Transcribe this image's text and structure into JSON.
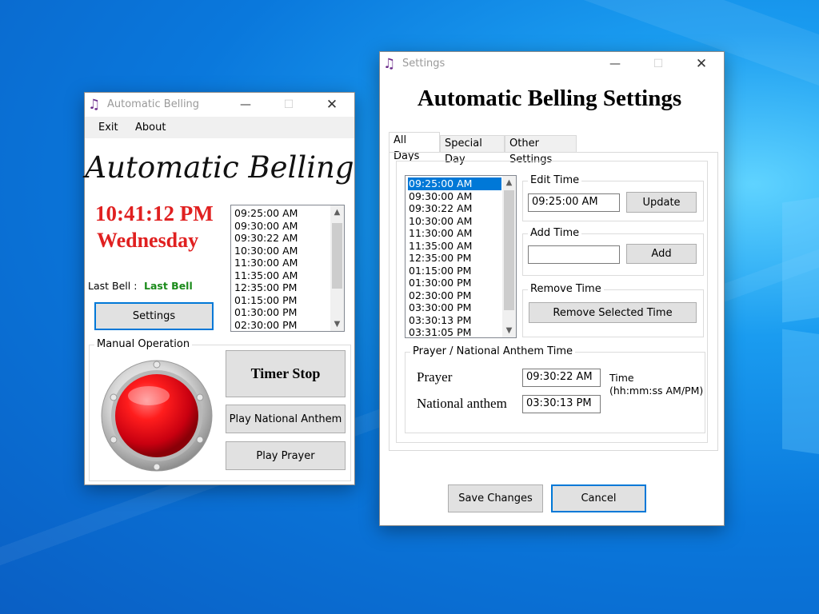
{
  "colors": {
    "desktop": "#0a78dc",
    "clock": "#e02020",
    "last_bell": "#1a8a1a",
    "selection": "#0078d7"
  },
  "main_window": {
    "title": "Automatic Belling",
    "icon": "music-note-icon",
    "menu": [
      "Exit",
      "About"
    ],
    "heading": "Automatic Belling",
    "time": "10:41:12 PM",
    "day": "Wednesday",
    "last_bell_label": "Last Bell :",
    "last_bell_value": "Last Bell",
    "settings_button": "Settings",
    "schedule": [
      "09:25:00 AM",
      "09:30:00 AM",
      "09:30:22 AM",
      "10:30:00 AM",
      "11:30:00 AM",
      "11:35:00 AM",
      "12:35:00 PM",
      "01:15:00 PM",
      "01:30:00 PM",
      "02:30:00 PM"
    ],
    "manual_operation": {
      "label": "Manual Operation",
      "timer_stop": "Timer Stop",
      "play_anthem": "Play National Anthem",
      "play_prayer": "Play Prayer"
    }
  },
  "settings_window": {
    "title": "Settings",
    "icon": "music-note-icon",
    "heading": "Automatic Belling Settings",
    "tabs": [
      "All Days",
      "Special Day",
      "Other Settings"
    ],
    "active_tab": "All Days",
    "times": [
      "09:25:00 AM",
      "09:30:00 AM",
      "09:30:22 AM",
      "10:30:00 AM",
      "11:30:00 AM",
      "11:35:00 AM",
      "12:35:00 PM",
      "01:15:00 PM",
      "01:30:00 PM",
      "02:30:00 PM",
      "03:30:00 PM",
      "03:30:13 PM",
      "03:31:05 PM"
    ],
    "selected_time": "09:25:00 AM",
    "edit_time": {
      "label": "Edit Time",
      "value": "09:25:00 AM",
      "button": "Update"
    },
    "add_time": {
      "label": "Add Time",
      "value": "",
      "button": "Add"
    },
    "remove_time": {
      "label": "Remove Time",
      "button": "Remove Selected Time"
    },
    "prayer_anthem": {
      "label": "Prayer / National Anthem Time",
      "prayer_label": "Prayer",
      "prayer_value": "09:30:22 AM",
      "anthem_label": "National anthem",
      "anthem_value": "03:30:13 PM",
      "hint_line1": "Time",
      "hint_line2": "(hh:mm:ss AM/PM)"
    },
    "save_button": "Save Changes",
    "cancel_button": "Cancel"
  }
}
